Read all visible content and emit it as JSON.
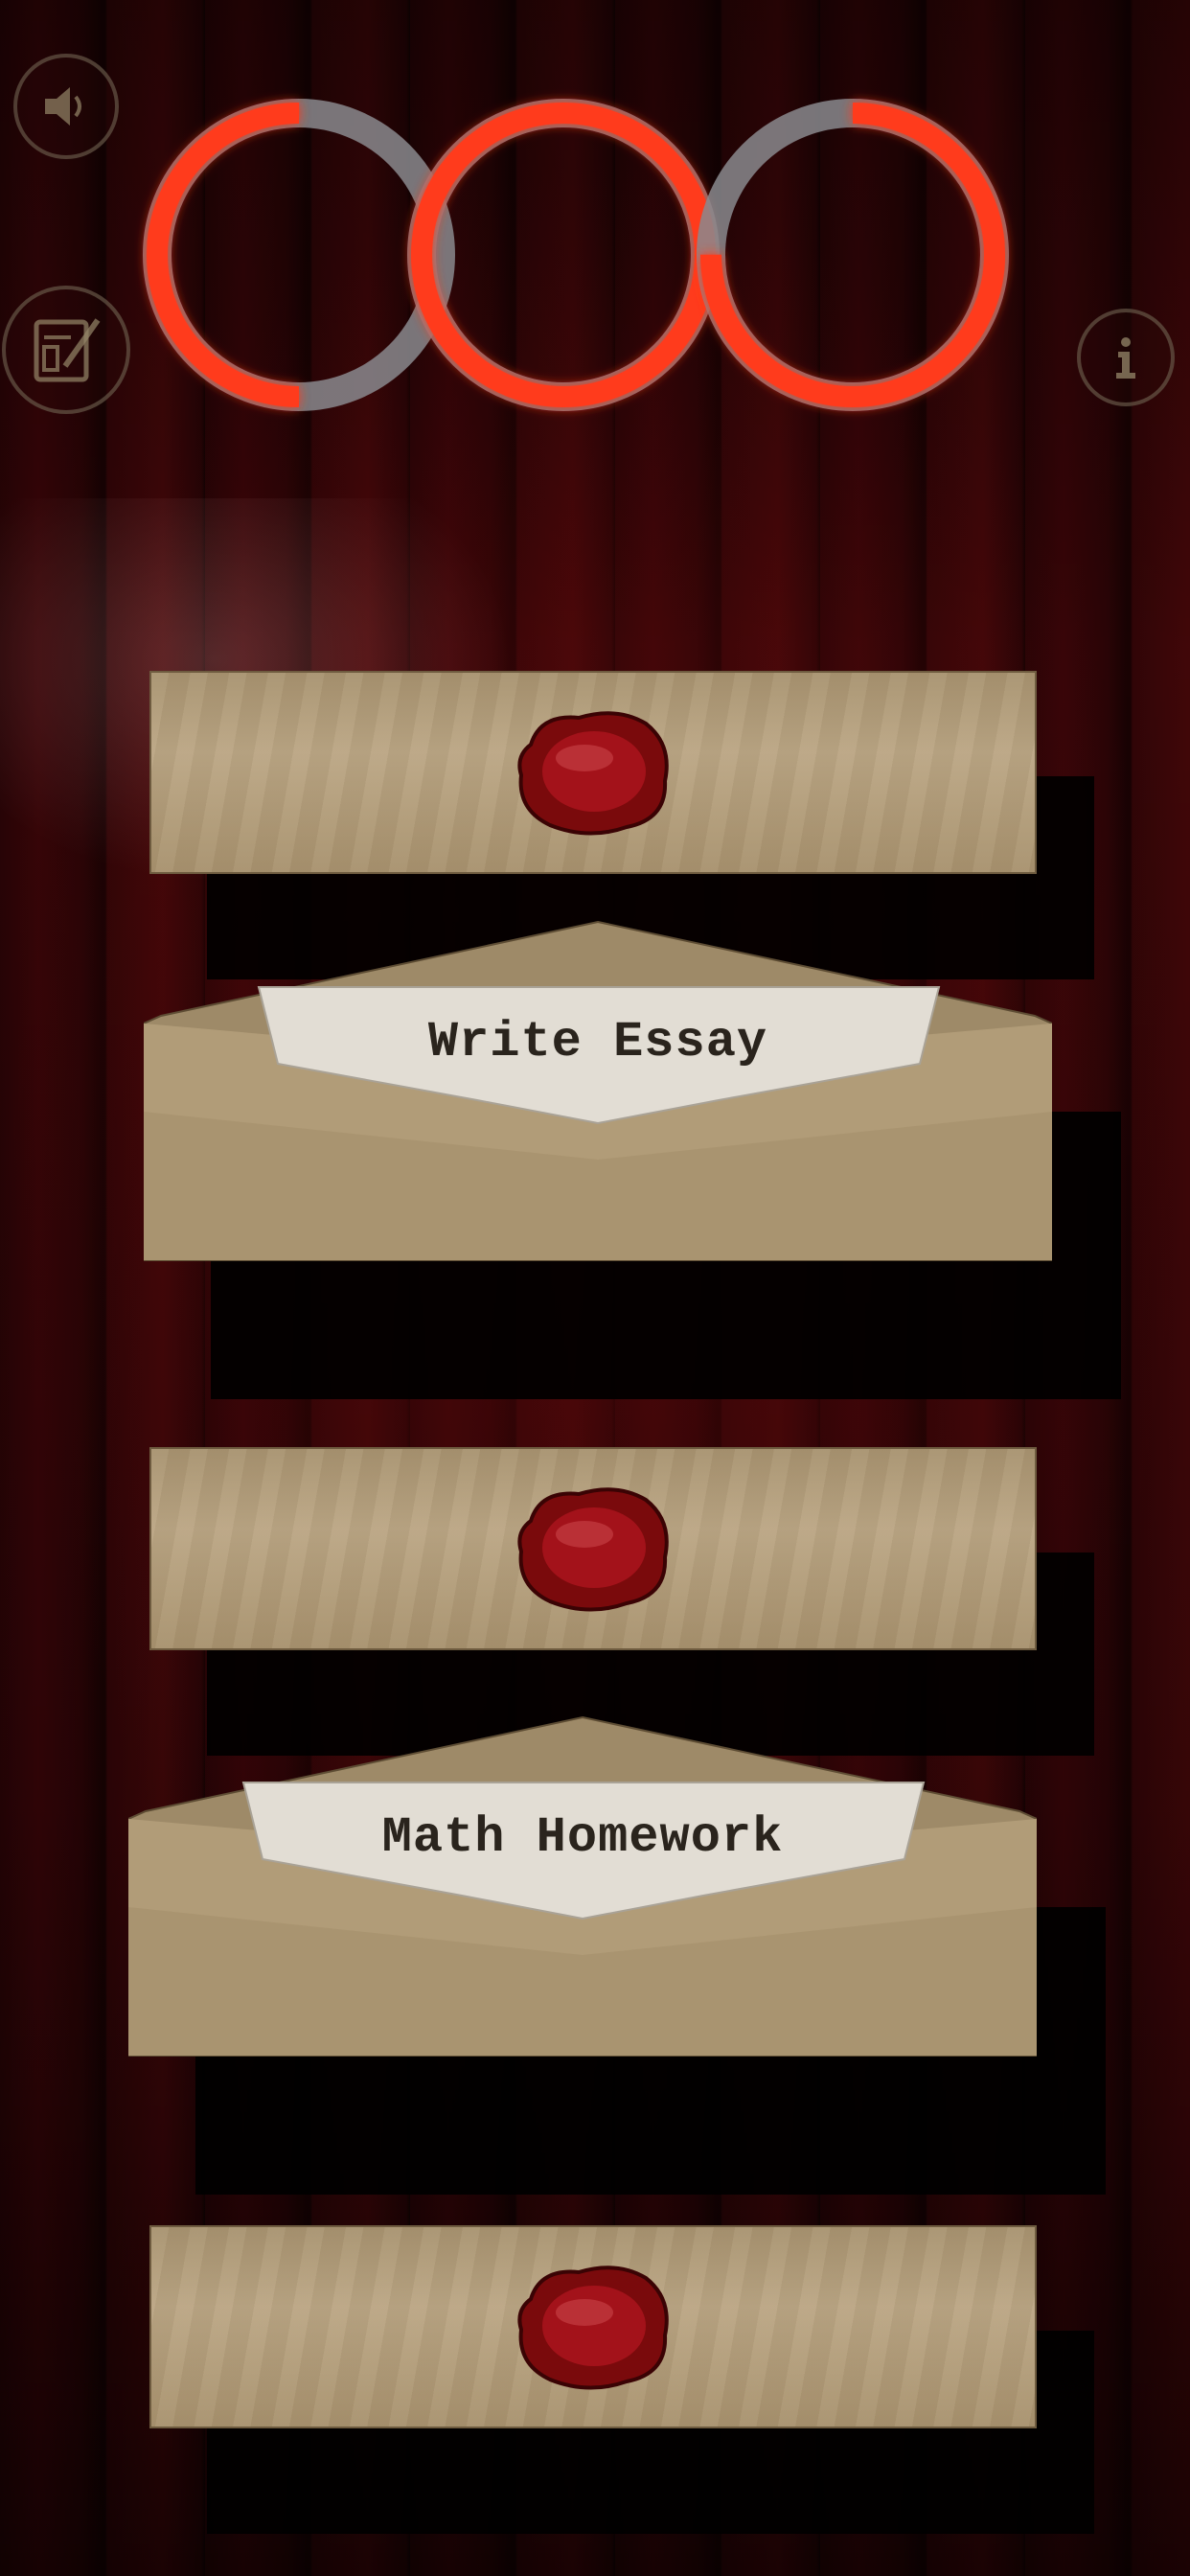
{
  "screen": {
    "background": "#2a0406",
    "accent": "#ff3a1e"
  },
  "top_bar": {
    "sound_icon": "speaker-icon",
    "notes_icon": "notepad-pencil-icon",
    "info_icon": "info-icon"
  },
  "rings": [
    {
      "name": "ring-left",
      "progress": 0.5
    },
    {
      "name": "ring-middle",
      "progress": 1.0
    },
    {
      "name": "ring-right",
      "progress": 0.75
    }
  ],
  "tasks": [
    {
      "type": "sealed-drawer",
      "seal_icon": "wax-seal-icon"
    },
    {
      "type": "open-envelope",
      "label": "Write Essay"
    },
    {
      "type": "sealed-drawer",
      "seal_icon": "wax-seal-icon"
    },
    {
      "type": "open-envelope",
      "label": "Math Homework"
    },
    {
      "type": "sealed-drawer",
      "seal_icon": "wax-seal-icon"
    }
  ]
}
